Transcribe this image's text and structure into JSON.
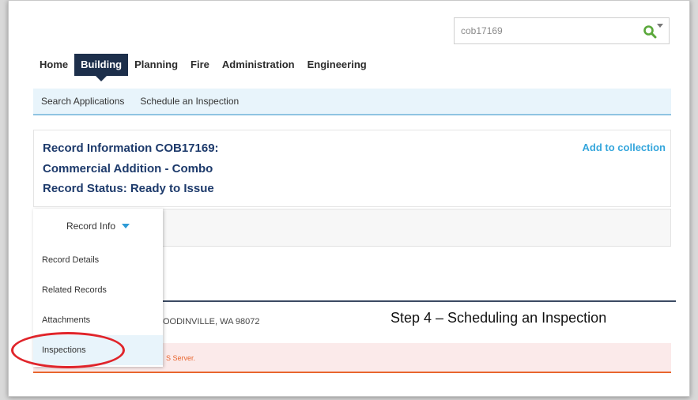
{
  "search": {
    "value": "cob17169"
  },
  "nav": {
    "items": [
      {
        "label": "Home",
        "active": false
      },
      {
        "label": "Building",
        "active": true
      },
      {
        "label": "Planning",
        "active": false
      },
      {
        "label": "Fire",
        "active": false
      },
      {
        "label": "Administration",
        "active": false
      },
      {
        "label": "Engineering",
        "active": false
      }
    ]
  },
  "subnav": {
    "items": [
      {
        "label": "Search Applications"
      },
      {
        "label": "Schedule an Inspection"
      }
    ]
  },
  "record": {
    "info_line": "Record Information COB17169:",
    "type_line": "Commercial Addition - Combo",
    "status_line": "Record Status: Ready to Issue",
    "add_to_collection": "Add to collection"
  },
  "dropdown": {
    "header": "Record Info",
    "items": [
      {
        "label": "Record Details",
        "selected": false
      },
      {
        "label": "Related Records",
        "selected": false
      },
      {
        "label": "Attachments",
        "selected": false
      },
      {
        "label": "Inspections",
        "selected": true
      }
    ]
  },
  "address": "OODINVILLE, WA 98072",
  "alert_text": "S Server.",
  "step_caption": "Step 4 – Scheduling an Inspection",
  "colors": {
    "nav_active_bg": "#1d2f4b",
    "accent_blue": "#35a6dc",
    "record_title": "#1d3a6b",
    "alert_orange": "#e8652e",
    "highlight_red": "#e0242a",
    "search_icon_green": "#5aa83a"
  }
}
